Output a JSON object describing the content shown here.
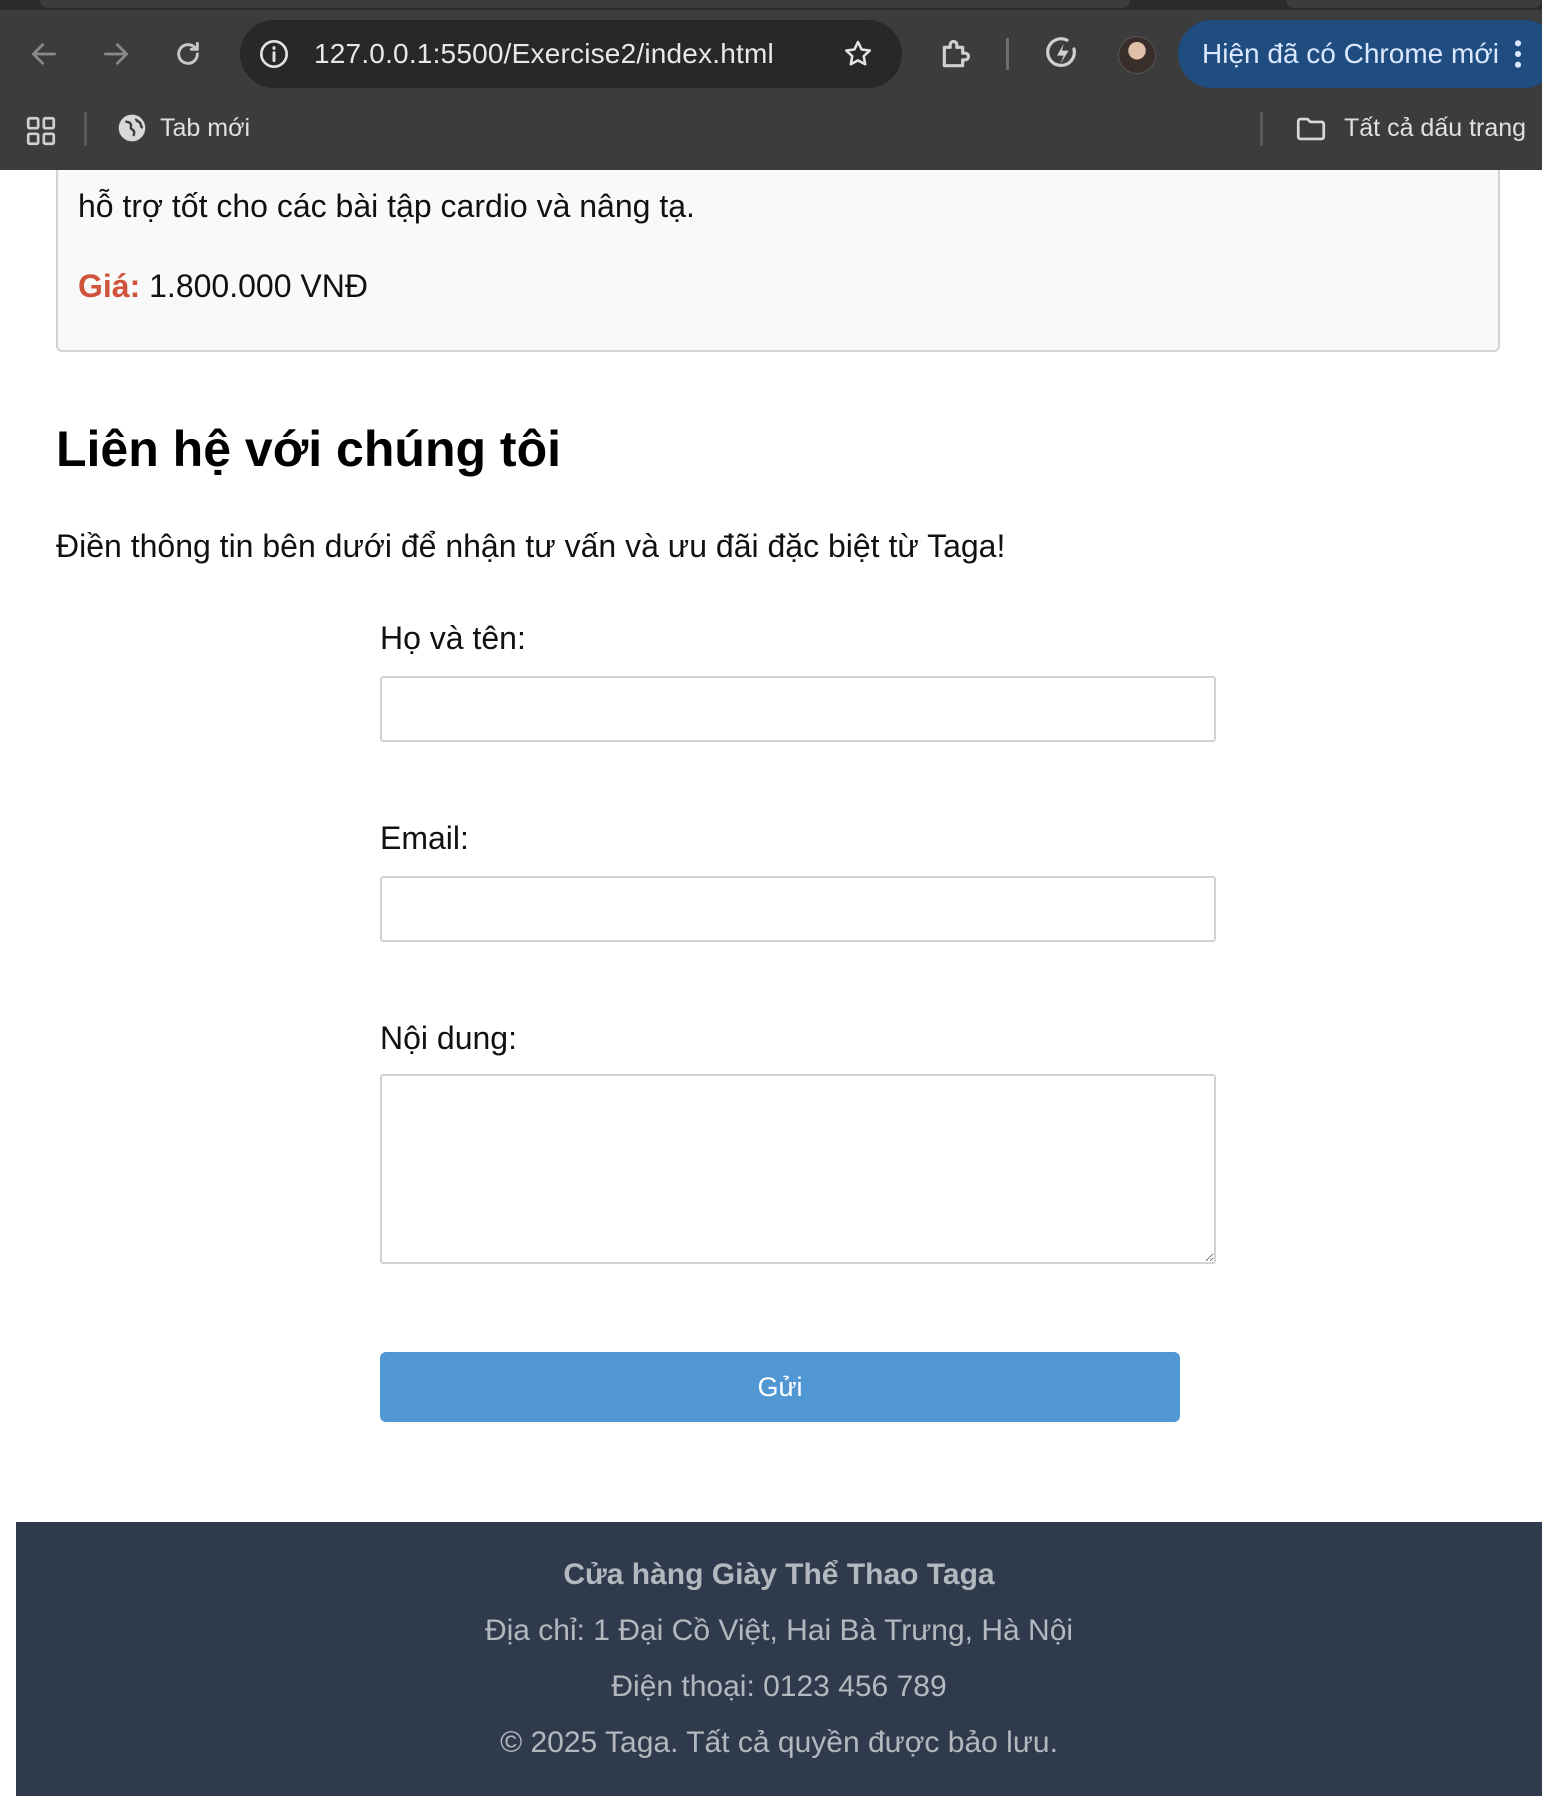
{
  "browser": {
    "url": "127.0.0.1:5500/Exercise2/index.html",
    "update_notice": "Hiện đã có Chrome mới",
    "bookmarks": {
      "new_tab": "Tab mới",
      "all_bookmarks": "Tất cả dấu trang"
    },
    "icons": [
      "back-icon",
      "forward-icon",
      "reload-icon",
      "info-icon",
      "star-icon",
      "extensions-icon",
      "performance-icon",
      "avatar",
      "more-menu-icon",
      "apps-icon",
      "globe-icon",
      "folder-icon"
    ]
  },
  "product": {
    "description_tail": "hỗ trợ tốt cho các bài tập cardio và nâng tạ.",
    "price_label": "Giá:",
    "price_value": "1.800.000 VNĐ"
  },
  "contact": {
    "title": "Liên hệ với chúng tôi",
    "intro": "Điền thông tin bên dưới để nhận tư vấn và ưu đãi đặc biệt từ Taga!",
    "name_label": "Họ và tên:",
    "name_value": "",
    "email_label": "Email:",
    "email_value": "",
    "message_label": "Nội dung:",
    "message_value": "",
    "submit_label": "Gửi"
  },
  "footer": {
    "store_name": "Cửa hàng Giày Thể Thao Taga",
    "address": "Địa chỉ: 1 Đại Cồ Việt, Hai Bà Trưng, Hà Nội",
    "phone": "Điện thoại: 0123 456 789",
    "copyright": "© 2025 Taga. Tất cả quyền được bảo lưu."
  },
  "colors": {
    "chrome_bg": "#3c3c3c",
    "omnibox_bg": "#282828",
    "update_pill": "#1f4d80",
    "price_label": "#d0543b",
    "submit_button": "#5197d4",
    "footer_bg": "#2f3b4c",
    "footer_text": "#b3b8bf"
  }
}
